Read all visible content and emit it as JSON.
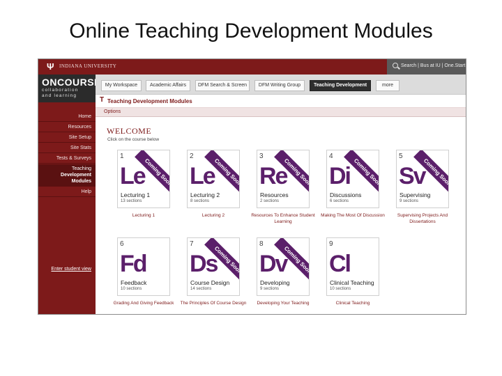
{
  "slide": {
    "title": "Online Teaching Development Modules"
  },
  "university_bar": {
    "logo_glyph": "Ψ",
    "name": "INDIANA UNIVERSITY",
    "search_links": "Search | Bus at IU | One.Start"
  },
  "brand": {
    "title": "ONCOURSE",
    "subtitle_1": "collaboration",
    "subtitle_2": "and learning"
  },
  "tabs": [
    {
      "label": "My Workspace"
    },
    {
      "label": "Academic Affairs"
    },
    {
      "label": "DFM Search & Screen"
    },
    {
      "label": "DFM Writing Group"
    },
    {
      "label": "Teaching Development"
    },
    {
      "label": "more"
    }
  ],
  "site": {
    "mark": "T",
    "title": "Teaching Development Modules",
    "options_label": "Options"
  },
  "sidebar": {
    "items": [
      {
        "label": "Home"
      },
      {
        "label": "Resources"
      },
      {
        "label": "Site Setup"
      },
      {
        "label": "Site Stats"
      },
      {
        "label": "Tests & Surveys"
      },
      {
        "label_1": "Teaching",
        "label_2": "Development",
        "label_3": "Modules"
      },
      {
        "label": "Help"
      }
    ],
    "enter_student_view": "Enter student view"
  },
  "main": {
    "welcome": "WELCOME",
    "instruction": "Click on the course below",
    "ribbon_text": "Coming Soon",
    "modules": [
      {
        "num": "1",
        "abbr": "Le",
        "name": "Lecturing 1",
        "sections": "13 sections",
        "caption": "Lecturing 1",
        "ribbon": true
      },
      {
        "num": "2",
        "abbr": "Le",
        "name": "Lecturing 2",
        "sections": "8 sections",
        "caption": "Lecturing 2",
        "ribbon": true
      },
      {
        "num": "3",
        "abbr": "Re",
        "name": "Resources",
        "sections": "2 sections",
        "caption": "Resources To Enhance Student Learning",
        "ribbon": true
      },
      {
        "num": "4",
        "abbr": "Di",
        "name": "Discussions",
        "sections": "6 sections",
        "caption": "Making The Most Of Discussion",
        "ribbon": true
      },
      {
        "num": "5",
        "abbr": "Sv",
        "name": "Supervising",
        "sections": "9 sections",
        "caption": "Supervising Projects And Dissertations",
        "ribbon": true
      },
      {
        "num": "6",
        "abbr": "Fd",
        "name": "Feedback",
        "sections": "10 sections",
        "caption": "Grading And Giving Feedback",
        "ribbon": false
      },
      {
        "num": "7",
        "abbr": "Ds",
        "name": "Course Design",
        "sections": "14 sections",
        "caption": "The Principles Of Course Design",
        "ribbon": true
      },
      {
        "num": "8",
        "abbr": "Dv",
        "name": "Developing",
        "sections": "9 sections",
        "caption": "Developing Your Teaching",
        "ribbon": true
      },
      {
        "num": "9",
        "abbr": "Cl",
        "name": "Clinical Teaching",
        "sections": "10 sections",
        "caption": "Clinical Teaching",
        "ribbon": false
      }
    ]
  },
  "colors": {
    "crimson": "#7d1a1a",
    "purple": "#5b1f6a",
    "dark": "#2b2b2b"
  }
}
